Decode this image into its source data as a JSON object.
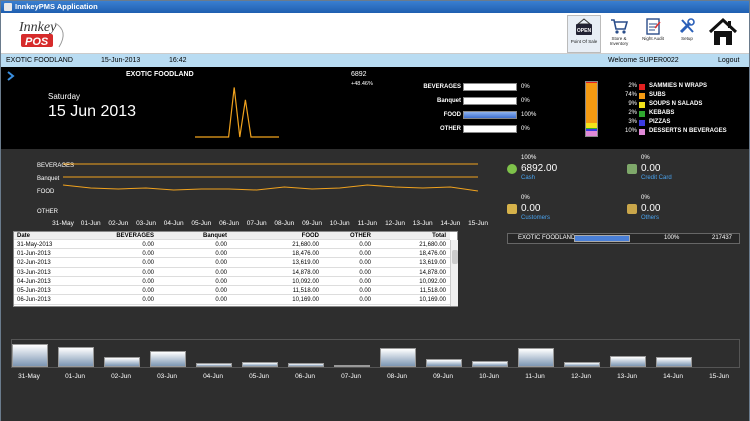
{
  "window": {
    "title": "InnkeyPMS Application"
  },
  "logo": {
    "line1": "Innkey",
    "line2": "POS"
  },
  "toolbar": {
    "pos_label": "Point Of Sale",
    "pos_sign": "OPEN",
    "store_label": "Store & Inventory",
    "night_label": "Night Audit",
    "setup_label": "Setup"
  },
  "status": {
    "outlet": "EXOTIC FOODLAND",
    "date": "15-Jun-2013",
    "time": "16:42",
    "welcome": "Welcome SUPER0022",
    "logout": "Logout"
  },
  "summary": {
    "outlet": "EXOTIC FOODLAND",
    "day": "Saturday",
    "date": "15 Jun 2013",
    "total": "6892",
    "change": "+48.46%"
  },
  "spark": [
    {
      "d": "31-May",
      "v": 0
    },
    {
      "d": "01-Jun",
      "v": 0
    },
    {
      "d": "02-Jun",
      "v": 0
    },
    {
      "d": "03-Jun",
      "v": 0
    },
    {
      "d": "04-Jun",
      "v": 0
    },
    {
      "d": "05-Jun",
      "v": 0
    },
    {
      "d": "06-Jun",
      "v": 0
    },
    {
      "d": "07-Jun",
      "v": 0.8
    },
    {
      "d": "08-Jun",
      "v": 0
    },
    {
      "d": "09-Jun",
      "v": 0.6
    },
    {
      "d": "10-Jun",
      "v": 0
    },
    {
      "d": "11-Jun",
      "v": 0
    },
    {
      "d": "12-Jun",
      "v": 0
    },
    {
      "d": "13-Jun",
      "v": 0
    },
    {
      "d": "14-Jun",
      "v": 0
    },
    {
      "d": "15-Jun",
      "v": 0
    }
  ],
  "categories": [
    {
      "name": "BEVERAGES",
      "pct": "0%",
      "fill": 0
    },
    {
      "name": "Banquet",
      "pct": "0%",
      "fill": 0
    },
    {
      "name": "FOOD",
      "pct": "100%",
      "fill": 1
    },
    {
      "name": "OTHER",
      "pct": "0%",
      "fill": 0
    }
  ],
  "subcats": [
    {
      "pct": "2%",
      "name": "SAMMIES N WRAPS",
      "color": "#e32020"
    },
    {
      "pct": "74%",
      "name": "SUBS",
      "color": "#f49a12"
    },
    {
      "pct": "9%",
      "name": "SOUPS N SALADS",
      "color": "#f2e21a"
    },
    {
      "pct": "2%",
      "name": "KEBABS",
      "color": "#2fa82f"
    },
    {
      "pct": "3%",
      "name": "PIZZAS",
      "color": "#3a3ae0"
    },
    {
      "pct": "10%",
      "name": "DESSERTS N BEVERAGES",
      "color": "#e08ad8"
    }
  ],
  "trend": {
    "labels": [
      "BEVERAGES",
      "Banquet",
      "FOOD",
      "OTHER"
    ],
    "dates": [
      "31-May",
      "01-Jun",
      "02-Jun",
      "03-Jun",
      "04-Jun",
      "05-Jun",
      "06-Jun",
      "07-Jun",
      "08-Jun",
      "09-Jun",
      "10-Jun",
      "11-Jun",
      "12-Jun",
      "13-Jun",
      "14-Jun",
      "15-Jun"
    ]
  },
  "payments": [
    {
      "pct": "100%",
      "value": "6892.00",
      "name": "Cash",
      "icon": "cash-icon"
    },
    {
      "pct": "0%",
      "value": "0.00",
      "name": "Credit Card",
      "icon": "credit-card-icon"
    },
    {
      "pct": "0%",
      "value": "0.00",
      "name": "Customers",
      "icon": "customers-icon"
    },
    {
      "pct": "0%",
      "value": "0.00",
      "name": "Others",
      "icon": "others-icon"
    }
  ],
  "outletbar": {
    "name": "EXOTIC FOODLAND",
    "pct": "100%",
    "value": "217437",
    "fill": 1
  },
  "table": {
    "headers": [
      "Date",
      "BEVERAGES",
      "Banquet",
      "FOOD",
      "OTHER",
      "Total"
    ],
    "rows": [
      [
        "31-May-2013",
        "0.00",
        "0.00",
        "21,680.00",
        "0.00",
        "21,680.00"
      ],
      [
        "01-Jun-2013",
        "0.00",
        "0.00",
        "18,476.00",
        "0.00",
        "18,476.00"
      ],
      [
        "02-Jun-2013",
        "0.00",
        "0.00",
        "13,619.00",
        "0.00",
        "13,619.00"
      ],
      [
        "03-Jun-2013",
        "0.00",
        "0.00",
        "14,878.00",
        "0.00",
        "14,878.00"
      ],
      [
        "04-Jun-2013",
        "0.00",
        "0.00",
        "10,092.00",
        "0.00",
        "10,092.00"
      ],
      [
        "05-Jun-2013",
        "0.00",
        "0.00",
        "11,518.00",
        "0.00",
        "11,518.00"
      ],
      [
        "06-Jun-2013",
        "0.00",
        "0.00",
        "10,169.00",
        "0.00",
        "10,169.00"
      ]
    ]
  },
  "daily": [
    {
      "d": "31-May",
      "v": 21680
    },
    {
      "d": "01-Jun",
      "v": 18476
    },
    {
      "d": "02-Jun",
      "v": 9000
    },
    {
      "d": "03-Jun",
      "v": 14878
    },
    {
      "d": "04-Jun",
      "v": 3500
    },
    {
      "d": "05-Jun",
      "v": 5000
    },
    {
      "d": "06-Jun",
      "v": 4000
    },
    {
      "d": "07-Jun",
      "v": 2000
    },
    {
      "d": "08-Jun",
      "v": 17500
    },
    {
      "d": "09-Jun",
      "v": 8000
    },
    {
      "d": "10-Jun",
      "v": 6000
    },
    {
      "d": "11-Jun",
      "v": 18000
    },
    {
      "d": "12-Jun",
      "v": 4500
    },
    {
      "d": "13-Jun",
      "v": 10500
    },
    {
      "d": "14-Jun",
      "v": 9500
    },
    {
      "d": "15-Jun",
      "v": 0
    }
  ],
  "colors": {
    "accent": "#f0a21e",
    "status_bar": "#b9dcf2",
    "bar_fill": "#5b8ad6"
  }
}
